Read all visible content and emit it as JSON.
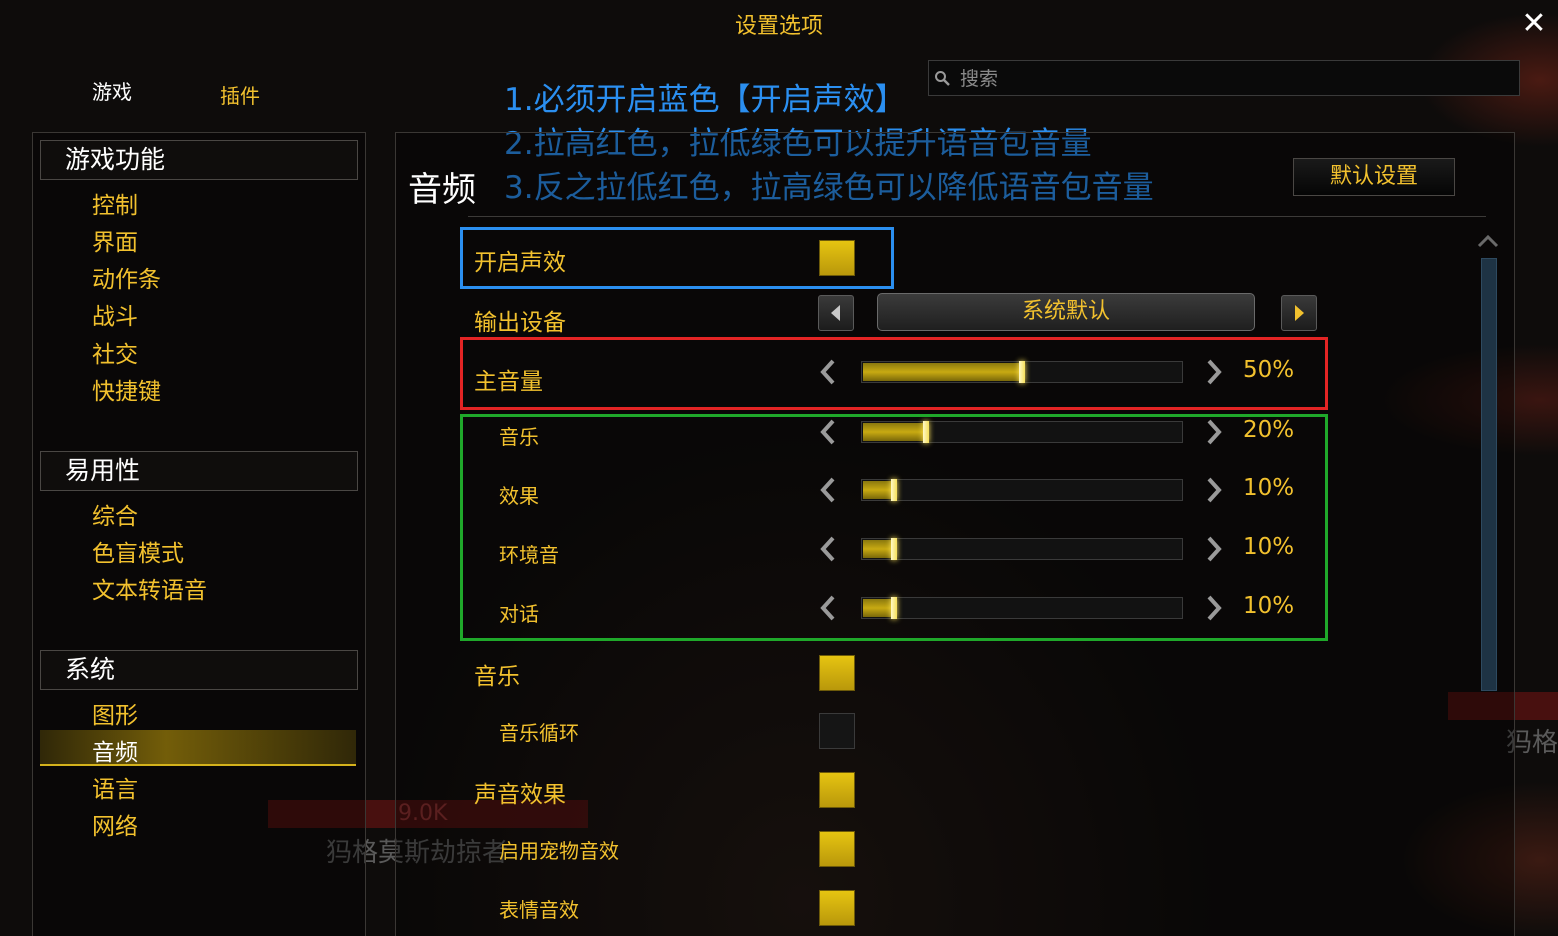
{
  "window": {
    "title": "设置选项",
    "close_label": "✕"
  },
  "top_tabs": {
    "game": "游戏",
    "addons": "插件"
  },
  "search": {
    "placeholder": "搜索"
  },
  "annotations": [
    "1.必须开启蓝色【开启声效】",
    "2.拉高红色，拉低绿色可以提升语音包音量",
    "3.反之拉低红色，拉高绿色可以降低语音包音量"
  ],
  "sidebar": {
    "sections": [
      {
        "header": "游戏功能",
        "items": [
          "控制",
          "界面",
          "动作条",
          "战斗",
          "社交",
          "快捷键"
        ]
      },
      {
        "header": "易用性",
        "items": [
          "综合",
          "色盲模式",
          "文本转语音"
        ]
      },
      {
        "header": "系统",
        "items": [
          "图形",
          "音频",
          "语言",
          "网络"
        ]
      }
    ],
    "selected": "音频"
  },
  "main": {
    "section_title": "音频",
    "default_button": "默认设置",
    "enable_sound": {
      "label": "开启声效",
      "checked": true
    },
    "output_device": {
      "label": "输出设备",
      "value": "系统默认"
    },
    "sliders": [
      {
        "label": "主音量",
        "value": 0.5,
        "display": "50%"
      },
      {
        "label": "音乐",
        "value": 0.2,
        "display": "20%"
      },
      {
        "label": "效果",
        "value": 0.1,
        "display": "10%"
      },
      {
        "label": "环境音",
        "value": 0.1,
        "display": "10%"
      },
      {
        "label": "对话",
        "value": 0.1,
        "display": "10%"
      }
    ],
    "toggles": [
      {
        "label": "音乐",
        "checked": true
      },
      {
        "label": "音乐循环",
        "checked": false
      },
      {
        "label": "声音效果",
        "checked": true
      },
      {
        "label": "启用宠物音效",
        "checked": true
      },
      {
        "label": "表情音效",
        "checked": true
      }
    ]
  },
  "background": {
    "damage_number": "9.0K",
    "npc_name": "犸格莫斯劫掠者",
    "npc_name_2": "犸格"
  },
  "colors": {
    "accent": "#f2c12e",
    "annotation_blue": "#2b8ff0",
    "highlight_blue": "#2b8ff0",
    "highlight_red": "#e32424",
    "highlight_green": "#1fa82a",
    "checkbox_on": "#d9b80f"
  }
}
